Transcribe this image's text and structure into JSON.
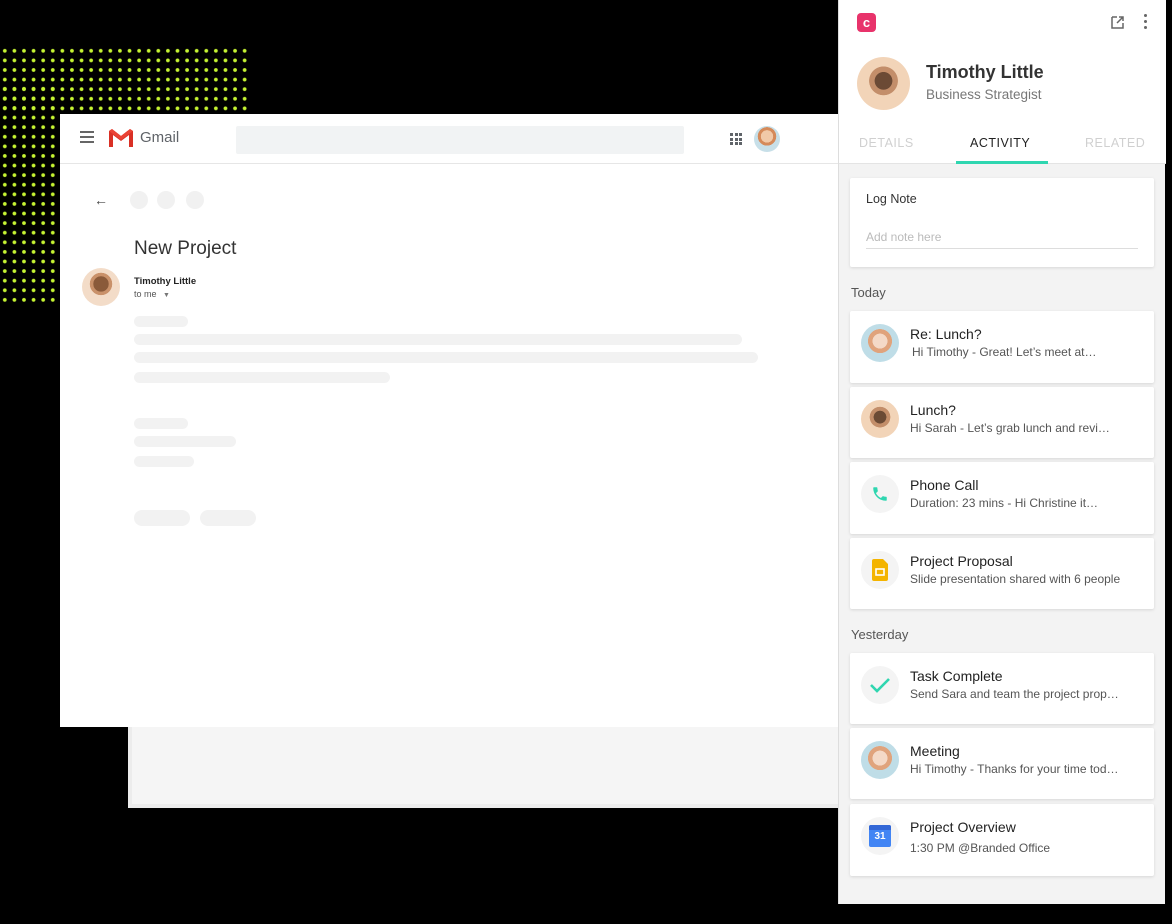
{
  "gmail": {
    "app_label": "Gmail",
    "email": {
      "subject": "New Project",
      "sender": "Timothy Little",
      "recipient": "to me"
    }
  },
  "crm_panel": {
    "logo_letter": "c",
    "contact": {
      "name": "Timothy Little",
      "title": "Business Strategist"
    },
    "tabs": [
      "DETAILS",
      "ACTIVITY",
      "RELATED"
    ],
    "active_tab": "ACTIVITY",
    "log_note": {
      "label": "Log Note",
      "placeholder": "Add note here"
    },
    "sections": [
      {
        "label": "Today",
        "items": [
          {
            "icon": "avatar-female",
            "title": "Re: Lunch?",
            "desc": "Hi Timothy -  Great! Let’s meet at…"
          },
          {
            "icon": "avatar-male",
            "title": "Lunch?",
            "desc": "Hi Sarah - Let’s grab lunch and revi…"
          },
          {
            "icon": "phone-icon",
            "title": "Phone Call",
            "desc": "Duration: 23 mins -  Hi Christine it…"
          },
          {
            "icon": "slides-icon",
            "title": "Project Proposal",
            "desc": "Slide presentation shared with 6 people"
          }
        ]
      },
      {
        "label": "Yesterday",
        "items": [
          {
            "icon": "checkmark-icon",
            "title": "Task Complete",
            "desc": "Send Sara and team the project prop…"
          },
          {
            "icon": "avatar-female",
            "title": "Meeting",
            "desc": "Hi Timothy - Thanks for your time tod…"
          },
          {
            "icon": "calendar-icon",
            "title": "Project Overview",
            "desc": "1:30 PM @Branded Office",
            "calendar_day": "31"
          }
        ]
      }
    ]
  },
  "colors": {
    "accent_teal": "#2fd6b0",
    "crm_brand": "#e8336b",
    "dot_pattern": "#c6f432",
    "slides_yellow": "#f4b400",
    "calendar_blue": "#4285f4"
  }
}
